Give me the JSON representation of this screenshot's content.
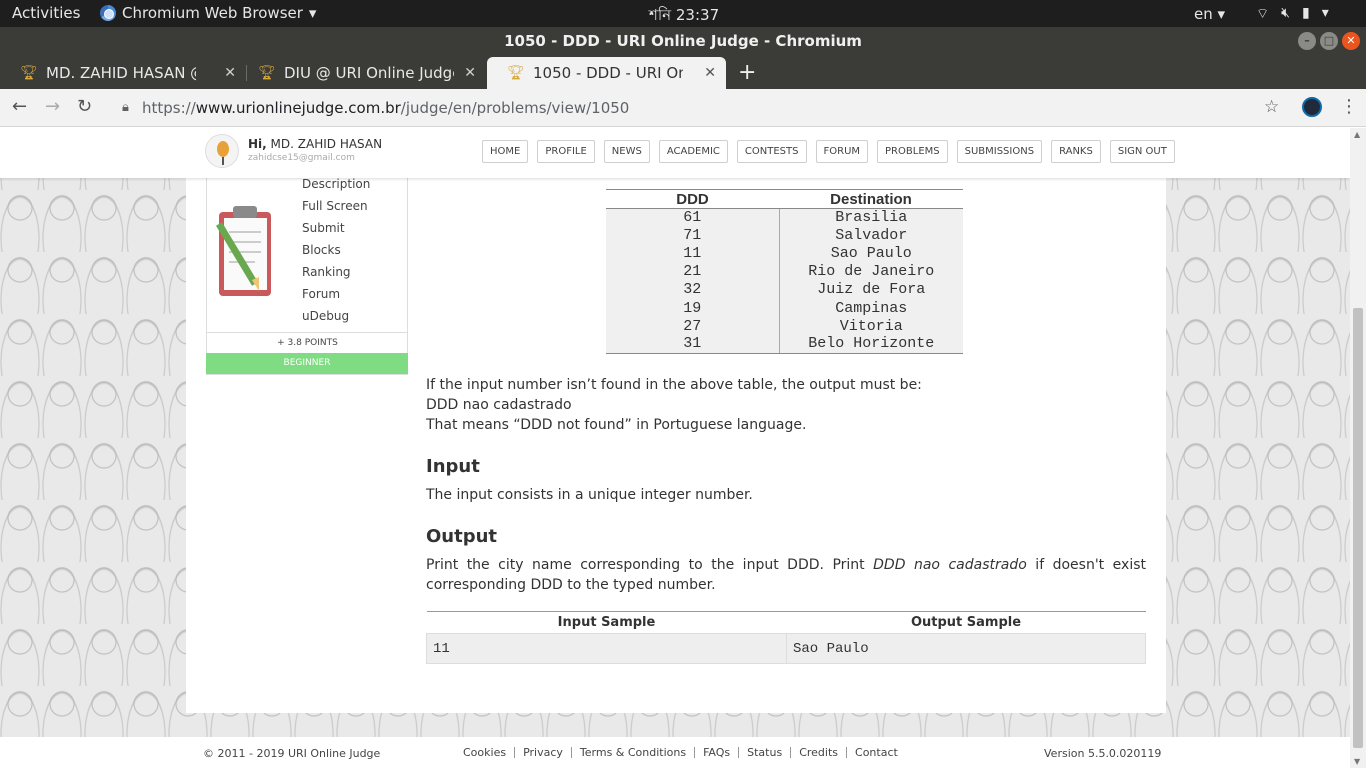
{
  "os": {
    "activities": "Activities",
    "app_name": "Chromium Web Browser",
    "clock": "শনি 23:37",
    "lang": "en"
  },
  "window": {
    "title": "1050 - DDD - URI Online Judge - Chromium"
  },
  "tabs": [
    {
      "label": "MD. ZAHID HASAN @ URI",
      "active": false
    },
    {
      "label": "DIU @ URI Online Judge",
      "active": false
    },
    {
      "label": "1050 - DDD - URI Online Judge",
      "active": true
    }
  ],
  "address": {
    "prefix": "https://",
    "domain": "www.urionlinejudge.com.br",
    "path": "/judge/en/problems/view/1050"
  },
  "header": {
    "greeting_bold": "Hi,",
    "user_name": "MD. ZAHID HASAN",
    "email": "zahidcse15@gmail.com",
    "nav": [
      "HOME",
      "PROFILE",
      "NEWS",
      "ACADEMIC",
      "CONTESTS",
      "FORUM",
      "PROBLEMS",
      "SUBMISSIONS",
      "RANKS",
      "SIGN OUT"
    ]
  },
  "sidebar": {
    "links": [
      "Description",
      "Full Screen",
      "Submit",
      "Blocks",
      "Ranking",
      "Forum",
      "uDebug"
    ],
    "points": "+ 3.8 POINTS",
    "level": "BEGINNER"
  },
  "ddd_table": {
    "headers": [
      "DDD",
      "Destination"
    ],
    "rows": [
      [
        "61",
        "Brasilia"
      ],
      [
        "71",
        "Salvador"
      ],
      [
        "11",
        "Sao Paulo"
      ],
      [
        "21",
        "Rio de Janeiro"
      ],
      [
        "32",
        "Juiz de Fora"
      ],
      [
        "19",
        "Campinas"
      ],
      [
        "27",
        "Vitoria"
      ],
      [
        "31",
        "Belo Horizonte"
      ]
    ]
  },
  "problem": {
    "not_found_line": "If the input number isn’t found in the above table, the output must be:",
    "not_found_value": "DDD nao cadastrado",
    "meaning_line": "That means “DDD not found” in Portuguese language.",
    "input_heading": "Input",
    "input_text": "The input consists in a unique integer number.",
    "output_heading": "Output",
    "output_text_1": "Print the city name corresponding to the input DDD. Print ",
    "output_text_em": "DDD nao cadastrado",
    "output_text_2": " if doesn't exist corresponding DDD to the typed number."
  },
  "samples": {
    "input_header": "Input Sample",
    "output_header": "Output Sample",
    "input": "11",
    "output": "Sao Paulo"
  },
  "footer": {
    "copyright": "© 2011 - 2019 URI Online Judge",
    "links": [
      "Cookies",
      "Privacy",
      "Terms & Conditions",
      "FAQs",
      "Status",
      "Credits",
      "Contact"
    ],
    "version": "Version 5.5.0.020119"
  },
  "colors": {
    "level_badge": "#7fdc82",
    "close_button": "#e9541f"
  }
}
